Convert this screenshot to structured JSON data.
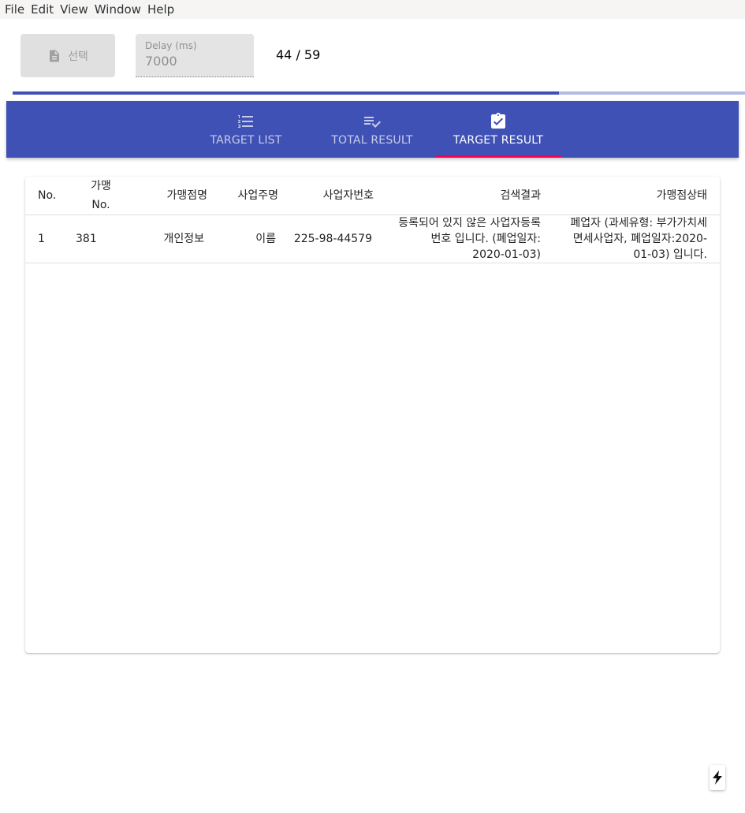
{
  "menu": {
    "items": [
      "File",
      "Edit",
      "View",
      "Window",
      "Help"
    ]
  },
  "toolbar": {
    "select_label": "선택",
    "select_icon": "file-document-icon",
    "delay_label": "Delay (ms)",
    "delay_value": "7000",
    "progress_text": "44 / 59",
    "progress_fraction": 0.746
  },
  "tabs": [
    {
      "label": "TARGET LIST",
      "icon": "format-list-numbered-icon",
      "active": false
    },
    {
      "label": "TOTAL RESULT",
      "icon": "playlist-check-icon",
      "active": false
    },
    {
      "label": "TARGET RESULT",
      "icon": "clipboard-check-icon",
      "active": true
    }
  ],
  "table": {
    "headers": [
      "No.",
      "가맹\nNo.",
      "가맹점명",
      "사업주명",
      "사업자번호",
      "검색결과",
      "가맹점상태"
    ],
    "rows": [
      [
        "1",
        "381",
        "개인정보",
        "이름",
        "225-98-44579",
        "등록되어 있지 않은 사업자등록번호 입니다. (폐업일자: 2020-01-03)",
        "폐업자 (과세유형: 부가가치세 면세사업자, 폐업일자:2020-01-03) 입니다."
      ]
    ]
  },
  "colors": {
    "primary": "#3f51b5",
    "accent": "#f50057",
    "progress_track": "#b4bbe6"
  }
}
